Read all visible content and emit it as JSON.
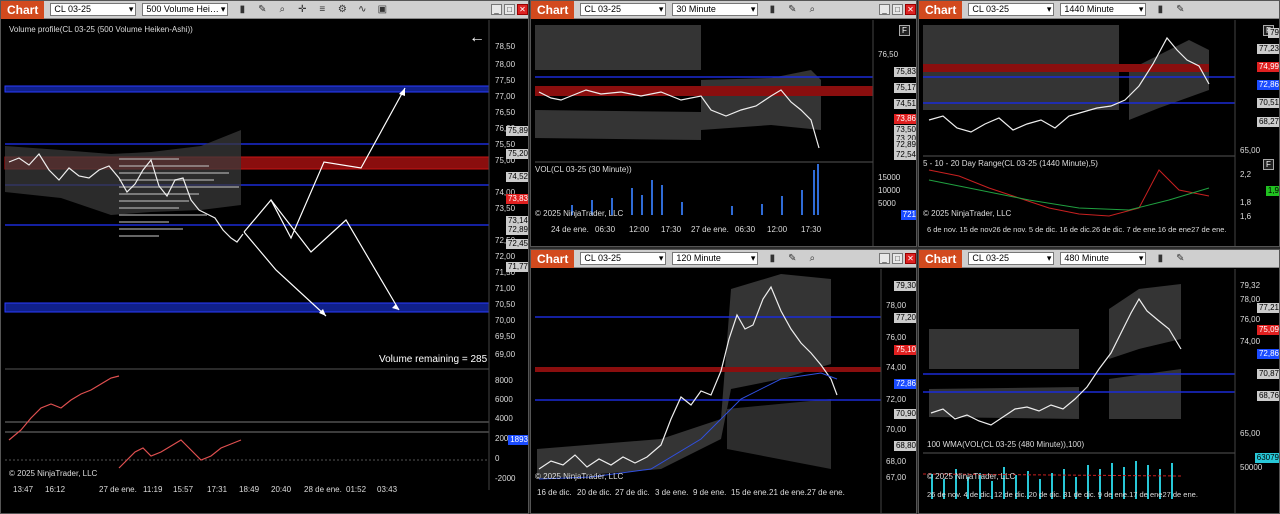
{
  "windows": {
    "w1": {
      "tab": "Chart",
      "instrument": "CL 03-25",
      "period": "500 Volume Hei…",
      "indicator": "Volume profile(CL 03-25 (500 Volume Heiken-Ashi))",
      "volume_remaining": "Volume remaining = 285",
      "copyright": "© 2025 NinjaTrader, LLC",
      "price_axis": [
        "78,50",
        "78,00",
        "77,50",
        "77,00",
        "76,50",
        "76,00",
        "75,50",
        "75,00",
        "74,50",
        "74,00",
        "73,50",
        "73,00",
        "72,50",
        "72,00",
        "71,50",
        "71,00",
        "70,50",
        "70,00",
        "69,50",
        "69,00"
      ],
      "price_labels": {
        "p1": "75,89",
        "p2": "75,20",
        "p3": "74,52",
        "p4": "73,83",
        "p5": "73,14",
        "p6": "72,89",
        "p7": "72,45",
        "p8": "71,77"
      },
      "sub_axis": [
        "8000",
        "6000",
        "4000",
        "2000",
        "0",
        "-2000"
      ],
      "sub_label": "1893",
      "time_axis": [
        "13:47",
        "16:12",
        "27 de ene.",
        "11:19",
        "15:57",
        "17:31",
        "18:49",
        "20:40",
        "28 de ene.",
        "01:52",
        "03:43"
      ]
    },
    "w2": {
      "tab": "Chart",
      "instrument": "CL 03-25",
      "period": "30 Minute",
      "price_axis": [
        "76,50",
        "75,83",
        "75,50",
        "75,17",
        "74,51",
        "73,86",
        "73,50",
        "73,20",
        "72,89",
        "72,54"
      ],
      "price_labels": {
        "p1": "75,83",
        "p2": "75,17",
        "p3": "74,51",
        "p4": "73,86",
        "p5": "73,50",
        "p6": "73,20",
        "p7": "72,89",
        "p8": "72,54"
      },
      "vol_indicator": "VOL(CL 03-25 (30 Minute))",
      "vol_axis": [
        "15000",
        "10000",
        "5000"
      ],
      "vol_label": "721",
      "copyright": "© 2025 NinjaTrader, LLC",
      "time_axis": [
        "24 de ene.",
        "06:30",
        "12:00",
        "17:30",
        "27 de ene.",
        "06:30",
        "12:00",
        "17:30"
      ]
    },
    "w3": {
      "tab": "Chart",
      "instrument": "CL 03-25",
      "period": "1440 Minute",
      "price_axis": [
        "79",
        "77,23",
        "74,99",
        "72,86",
        "70,51",
        "68,27",
        "65,00"
      ],
      "price_labels": {
        "p1": "79",
        "p2": "77,23",
        "p3": "74,99",
        "p4": "72,86",
        "p5": "70,51",
        "p6": "68,27"
      },
      "ind_title": "5 - 10 - 20 Day Range(CL 03-25 (1440 Minute),5)",
      "ind_axis": [
        "2,2",
        "1,9",
        "1,8",
        "1,6"
      ],
      "ind_label": "1,9",
      "copyright": "© 2025 NinjaTrader, LLC",
      "time_axis": "6 de nov. 15 de nov26 de nov. 5 de dic. 16 de dic.26 de dic. 7 de ene.16 de ene27 de ene."
    },
    "w4": {
      "tab": "Chart",
      "instrument": "CL 03-25",
      "period": "120 Minute",
      "price_axis": [
        "79,30",
        "78,00",
        "77,20",
        "76,00",
        "75,10",
        "74,00",
        "72,86",
        "72,00",
        "70,90",
        "70,00",
        "68,80",
        "68,00",
        "67,00"
      ],
      "price_labels": {
        "p1": "79,30",
        "p2": "77,20",
        "p3": "75,10",
        "p4": "72,86",
        "p5": "70,90",
        "p6": "68,80"
      },
      "copyright": "© 2025 NinjaTrader, LLC",
      "time_axis": [
        "16 de dic.",
        "20 de dic.",
        "27 de dic.",
        "3 de ene.",
        "9 de ene.",
        "15 de ene.",
        "21 de ene.",
        "27 de ene."
      ]
    },
    "w5": {
      "tab": "Chart",
      "instrument": "CL 03-25",
      "period": "480 Minute",
      "price_axis": [
        "79,32",
        "78,00",
        "77,21",
        "76,00",
        "75,09",
        "74,00",
        "72,86",
        "70,87",
        "68,76",
        "65,00"
      ],
      "price_labels": {
        "p1": "79,32",
        "p2": "77,21",
        "p3": "75,09",
        "p4": "72,86",
        "p5": "70,87",
        "p6": "68,76"
      },
      "vol_indicator": "100 WMA(VOL(CL 03-25 (480 Minute)),100)",
      "vol_axis": [
        "50000"
      ],
      "vol_label": "63079",
      "copyright": "© 2025 NinjaTrader, LLC",
      "time_axis": "26 de nov. 4 de dic. 12 de dic. 20 de dic. 31 de dic. 9 de ene.17 de ene27 de ene."
    }
  },
  "colors": {
    "support_blue": "#1a2bd6",
    "resistance_red": "#c81414",
    "chart_tab": "#d24a1e"
  }
}
